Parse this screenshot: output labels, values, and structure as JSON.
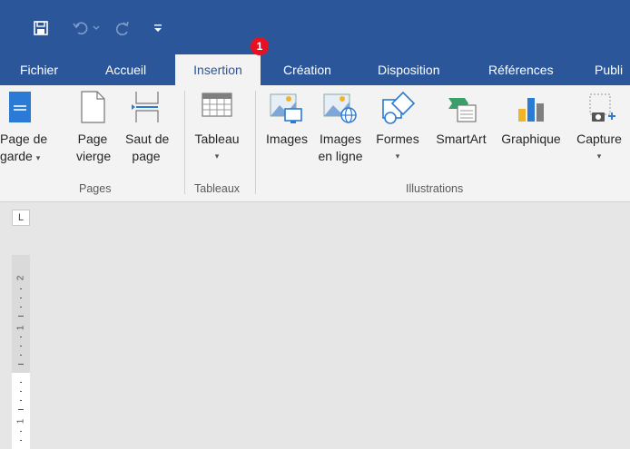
{
  "badge": "1",
  "tabs": {
    "fichier": "Fichier",
    "accueil": "Accueil",
    "insertion": "Insertion",
    "creation": "Création",
    "disposition": "Disposition",
    "references": "Références",
    "publi": "Publi"
  },
  "buttons": {
    "page_de_garde_1": "Page de",
    "page_de_garde_2": "garde",
    "page_vierge_1": "Page",
    "page_vierge_2": "vierge",
    "saut_de_page_1": "Saut de",
    "saut_de_page_2": "page",
    "tableau": "Tableau",
    "images": "Images",
    "images_en_ligne_1": "Images",
    "images_en_ligne_2": "en ligne",
    "formes": "Formes",
    "smartart": "SmartArt",
    "graphique": "Graphique",
    "capture": "Capture"
  },
  "groups": {
    "pages": "Pages",
    "tableaux": "Tableaux",
    "illustrations": "Illustrations"
  },
  "ruler": {
    "corner": "L",
    "n2": "2",
    "n1a": "1",
    "n1b": "1"
  },
  "colors": {
    "brand": "#2b579a",
    "ribbon": "#f3f3f3",
    "badge": "#e81123"
  }
}
